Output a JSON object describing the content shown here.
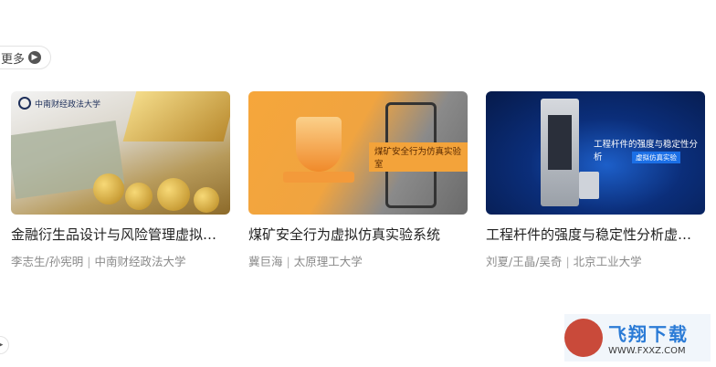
{
  "more_button": {
    "label": "更多",
    "icon": "chevron-right-icon"
  },
  "cards": [
    {
      "title": "金融衍生品设计与风险管理虚拟仿真实验",
      "teachers": "李志生/孙宪明",
      "school": "中南财经政法大学",
      "thumb_text": "中南财经政法大学"
    },
    {
      "title": "煤矿安全行为虚拟仿真实验系统",
      "teachers": "冀巨海",
      "school": "太原理工大学",
      "thumb_text": "煤矿安全行为仿真实验室"
    },
    {
      "title": "工程杆件的强度与稳定性分析虚拟仿真实验",
      "teachers": "刘夏/王晶/吴奇",
      "school": "北京工业大学",
      "thumb_text": "工程杆件的强度与稳定性分析",
      "thumb_sub": "虚拟仿真实验"
    }
  ],
  "watermark": {
    "title": "飞翔下载",
    "url": "WWW.FXXZ.COM"
  }
}
